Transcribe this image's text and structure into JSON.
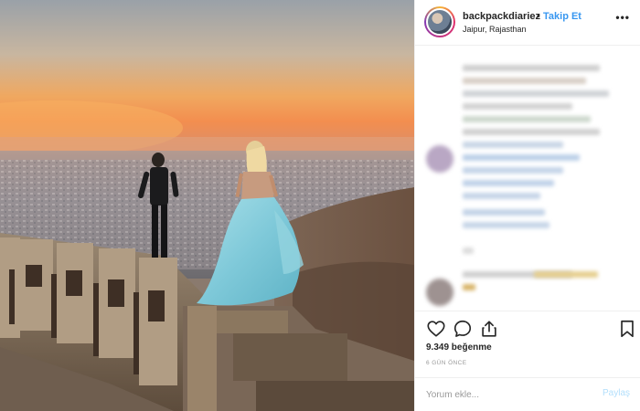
{
  "post": {
    "username": "backpackdiariez",
    "separator": "•",
    "follow_label": "Takip Et",
    "location": "Jaipur, Rajasthan",
    "more_icon": "more-dots-icon",
    "more_glyph": "•••"
  },
  "actions": {
    "like_icon": "heart-icon",
    "comment_icon": "comment-bubble-icon",
    "share_icon": "share-icon",
    "save_icon": "bookmark-icon"
  },
  "likes_text": "9.349 beğenme",
  "time_text": "6 GÜN ÖNCE",
  "comment_box": {
    "placeholder": "Yorum ekle...",
    "post_label": "Paylaş"
  },
  "colors": {
    "accent": "#3897f0",
    "post_disabled": "#b2dffc",
    "text": "#262626",
    "muted": "#999999"
  }
}
